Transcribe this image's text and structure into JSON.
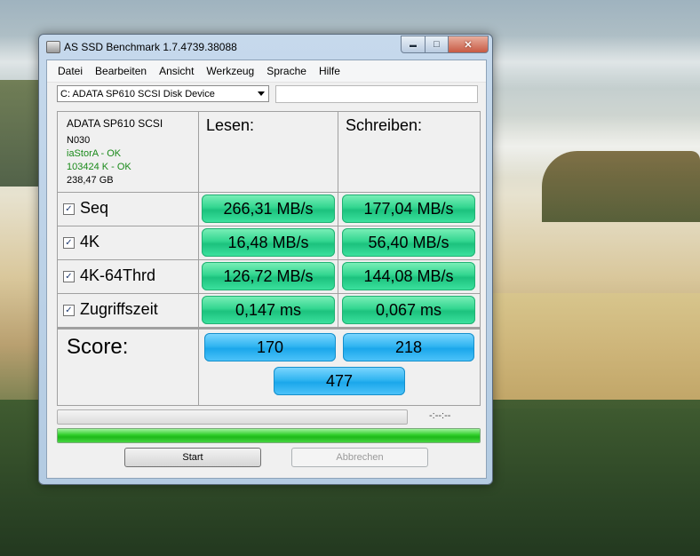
{
  "window": {
    "title": "AS SSD Benchmark 1.7.4739.38088",
    "controls": {
      "minimize": "▬",
      "maximize": "□",
      "close": "✕"
    }
  },
  "menu": [
    "Datei",
    "Bearbeiten",
    "Ansicht",
    "Werkzeug",
    "Sprache",
    "Hilfe"
  ],
  "drive_select": {
    "value": "C: ADATA SP610 SCSI Disk Device"
  },
  "info": {
    "name": "ADATA SP610 SCSI",
    "firmware": "N030",
    "driver": "iaStorA - OK",
    "alignment": "103424 K - OK",
    "capacity": "238,47 GB"
  },
  "headers": {
    "read": "Lesen:",
    "write": "Schreiben:"
  },
  "rows": [
    {
      "label": "Seq",
      "checked": true,
      "read": "266,31 MB/s",
      "write": "177,04 MB/s"
    },
    {
      "label": "4K",
      "checked": true,
      "read": "16,48 MB/s",
      "write": "56,40 MB/s"
    },
    {
      "label": "4K-64Thrd",
      "checked": true,
      "read": "126,72 MB/s",
      "write": "144,08 MB/s"
    },
    {
      "label": "Zugriffszeit",
      "checked": true,
      "read": "0,147 ms",
      "write": "0,067 ms"
    }
  ],
  "score": {
    "label": "Score:",
    "read": "170",
    "write": "218",
    "total": "477"
  },
  "progress": {
    "timer": "-:--:--",
    "fill_percent": 100
  },
  "buttons": {
    "start": "Start",
    "cancel": "Abbrechen"
  },
  "colors": {
    "value_green": "#33d690",
    "score_blue": "#33b6f1",
    "progress_green": "#2fce2a"
  }
}
